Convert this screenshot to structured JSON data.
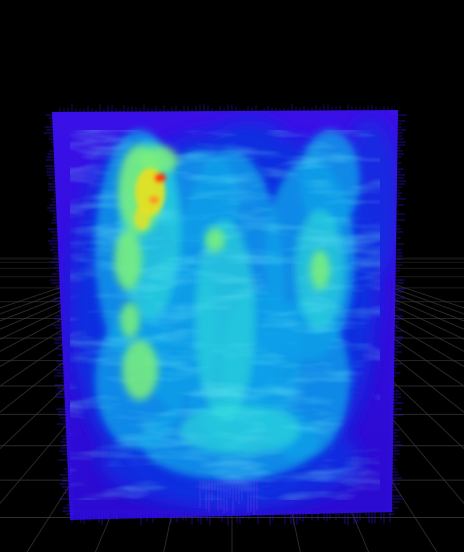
{
  "viewport": {
    "background_color": "#000000",
    "grid_color": "#3a3a3a",
    "grid_style": "perspective ground plane"
  },
  "volume": {
    "render_type": "heat-mapped fluid volume",
    "colormap": [
      "#3a10e8",
      "#0a2fe0",
      "#0aa0e8",
      "#30e0d8",
      "#7cf07a",
      "#e8e020",
      "#ff3010"
    ],
    "colormap_names": [
      "violet",
      "blue",
      "light-blue",
      "cyan",
      "green",
      "yellow",
      "red"
    ]
  }
}
